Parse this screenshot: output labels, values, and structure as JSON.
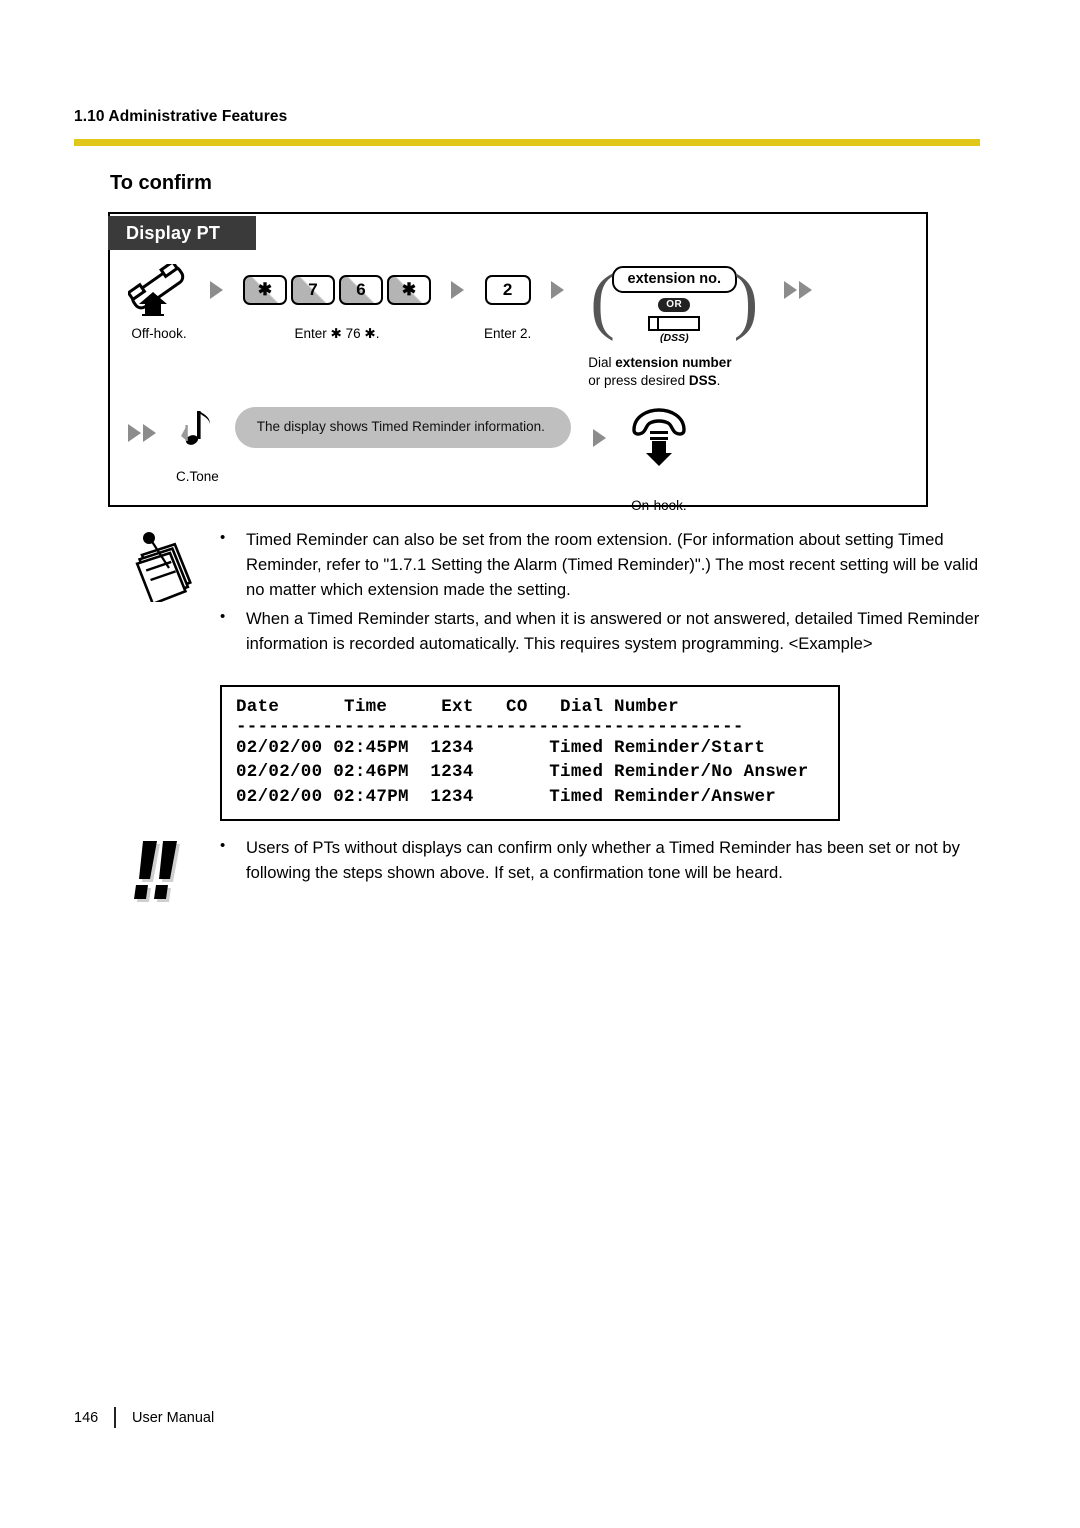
{
  "header": {
    "section": "1.10 Administrative Features",
    "rule_color": "#e0c719"
  },
  "page_title": "To confirm",
  "procedure": {
    "tab_label": "Display PT",
    "row1": [
      {
        "type": "icon",
        "icon": "offhook-handset-icon",
        "caption": "Off-hook."
      },
      {
        "type": "arrow",
        "count": 1
      },
      {
        "type": "keys",
        "keys": [
          "✱",
          "7",
          "6",
          "✱"
        ],
        "caption": "Enter ✱ 76 ✱."
      },
      {
        "type": "arrow",
        "count": 1
      },
      {
        "type": "key",
        "keys": [
          "2"
        ],
        "caption": "Enter 2."
      },
      {
        "type": "arrow",
        "count": 1
      },
      {
        "type": "extension",
        "pill": "extension no.",
        "or": "OR",
        "dss": "(DSS)",
        "caption_line1_pre": "Dial ",
        "caption_line1_bold": "extension number",
        "caption_line2_pre": "or press desired ",
        "caption_line2_bold": "DSS",
        "caption_line2_post": "."
      },
      {
        "type": "arrow",
        "count": 2
      }
    ],
    "row2": [
      {
        "type": "arrow",
        "count": 2
      },
      {
        "type": "icon",
        "icon": "confirmation-tone-icon",
        "caption": "C.Tone"
      },
      {
        "type": "bubble",
        "text": "The display shows Timed Reminder information."
      },
      {
        "type": "arrow",
        "count": 1
      },
      {
        "type": "icon",
        "icon": "onhook-handset-icon",
        "caption": "On-hook."
      }
    ]
  },
  "notes": {
    "memo": [
      "Timed Reminder can also be set from the room extension. (For information about setting Timed Reminder, refer to \"1.7.1 Setting the Alarm (Timed Reminder)\".) The most recent setting will be valid no matter which extension made the setting.",
      "When a Timed Reminder starts, and when it is answered or not answered, detailed Timed Reminder information is recorded automatically. This requires system programming. <Example>"
    ],
    "caution": [
      "Users of PTs without displays can confirm only whether a Timed Reminder has been set or not by following the steps shown above. If set, a confirmation tone will be heard."
    ]
  },
  "example_table": {
    "header": "Date      Time     Ext   CO   Dial Number",
    "separator": "-----------------------------------------------",
    "rows": [
      "02/02/00 02:45PM  1234       Timed Reminder/Start",
      "02/02/00 02:46PM  1234       Timed Reminder/No Answer",
      "02/02/00 02:47PM  1234       Timed Reminder/Answer"
    ],
    "columns": [
      "Date",
      "Time",
      "Ext",
      "CO",
      "Dial Number"
    ],
    "data": [
      {
        "date": "02/02/00",
        "time": "02:45PM",
        "ext": "1234",
        "co": "",
        "dial_number": "Timed Reminder/Start"
      },
      {
        "date": "02/02/00",
        "time": "02:46PM",
        "ext": "1234",
        "co": "",
        "dial_number": "Timed Reminder/No Answer"
      },
      {
        "date": "02/02/00",
        "time": "02:47PM",
        "ext": "1234",
        "co": "",
        "dial_number": "Timed Reminder/Answer"
      }
    ]
  },
  "footer": {
    "page_number": "146",
    "doc_title": "User Manual"
  }
}
